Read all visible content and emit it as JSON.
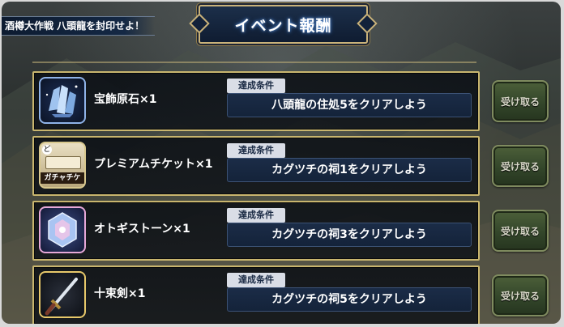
{
  "event_banner": "酒樽大作戦 八頭龍を封印せよ！",
  "title": "イベント報酬",
  "condition_label": "達成条件",
  "rewards": [
    {
      "name": "宝飾原石×1",
      "condition": "八頭龍の住処5をクリアしよう",
      "claim_label": "受け取る",
      "icon": "gem-cluster-icon"
    },
    {
      "name": "プレミアムチケット×1",
      "condition": "カグツチの祠1をクリアしよう",
      "claim_label": "受け取る",
      "icon": "gacha-ticket-icon",
      "icon_text": "ガチャチケ"
    },
    {
      "name": "オトギストーン×1",
      "condition": "カグツチの祠3をクリアしよう",
      "claim_label": "受け取る",
      "icon": "otogi-stone-icon"
    },
    {
      "name": "十束剣×1",
      "condition": "カグツチの祠5をクリアしよう",
      "claim_label": "受け取る",
      "icon": "sword-icon"
    }
  ],
  "colors": {
    "frame_gold": "#c8b56e",
    "condition_box": "#1b2c47",
    "claim_button": "#3a4d2e"
  }
}
